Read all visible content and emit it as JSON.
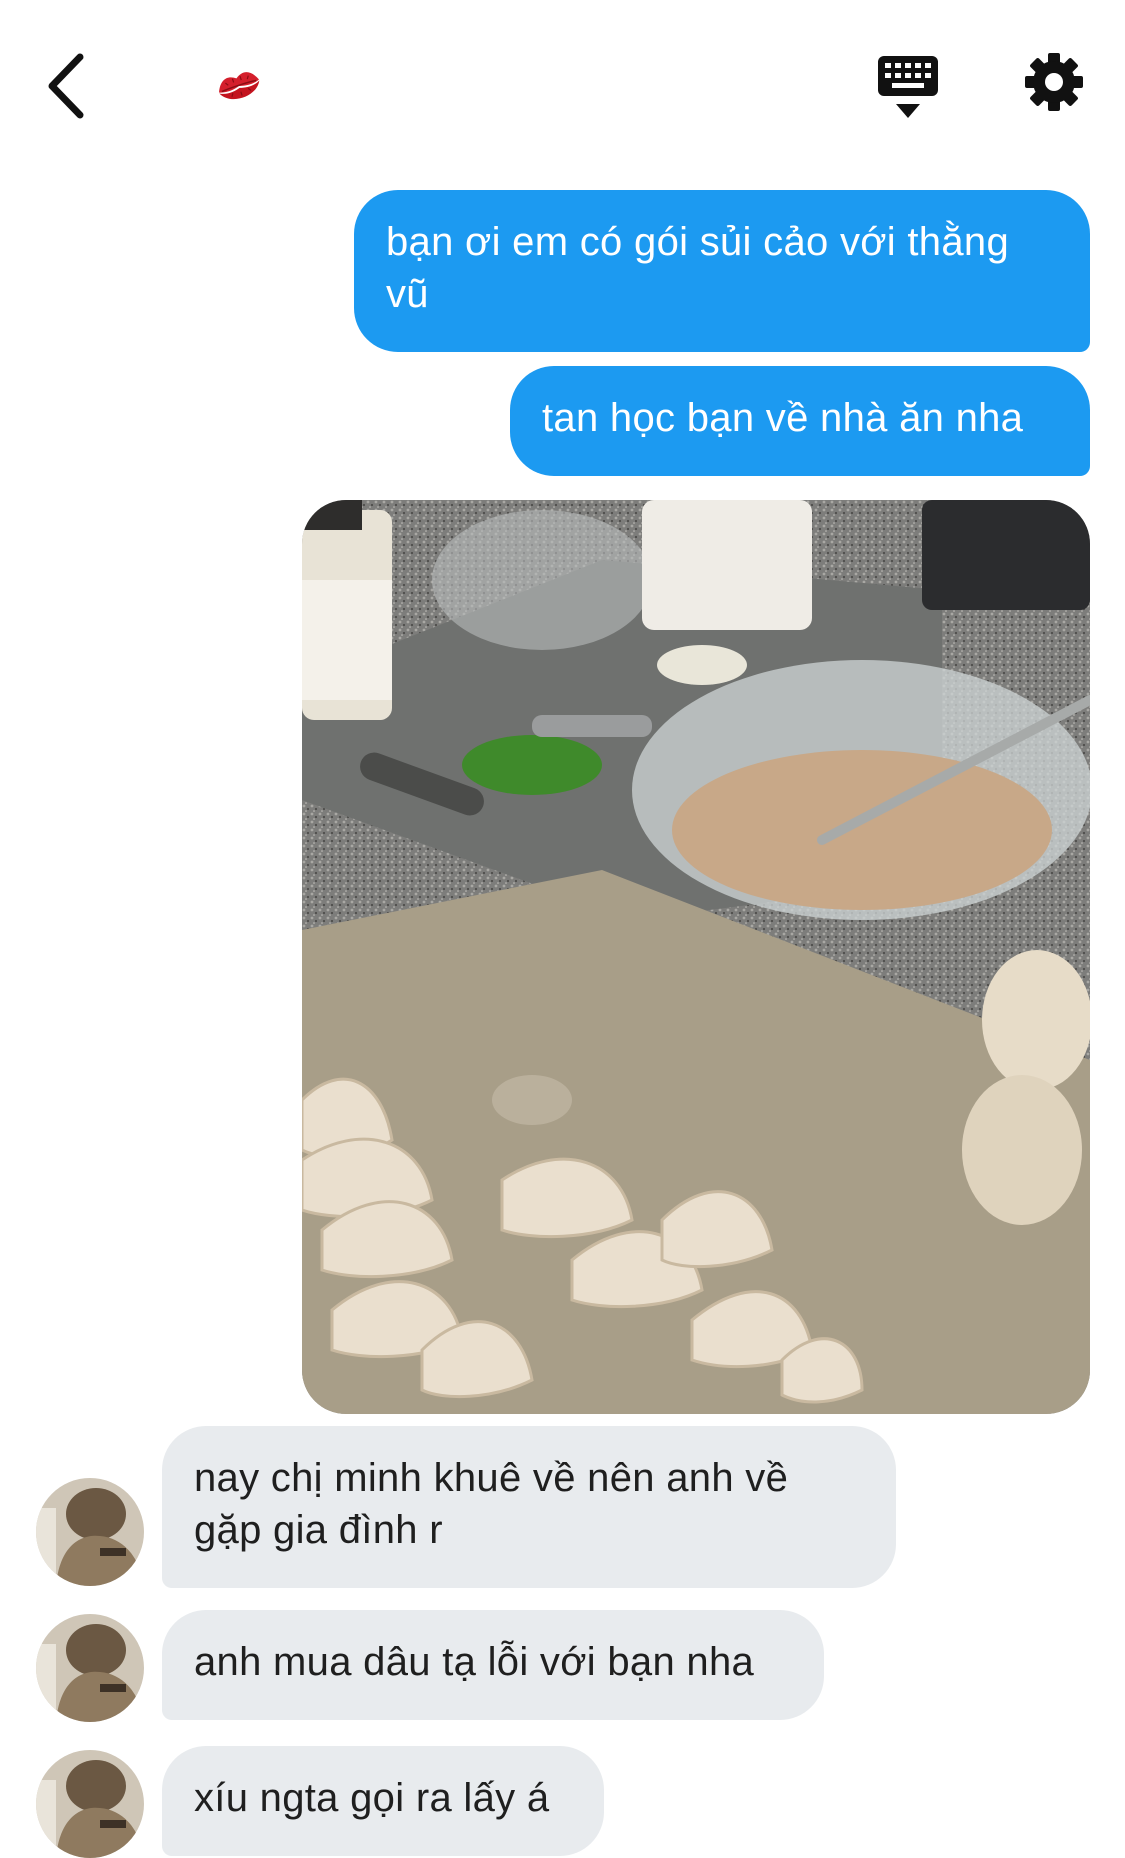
{
  "header": {
    "back_icon": "chevron-left-icon",
    "contact_icon": "kiss-lips-icon",
    "keyboard_icon": "keyboard-hide-icon",
    "settings_icon": "gear-icon"
  },
  "colors": {
    "outgoing_bubble": "#1c9af1",
    "incoming_bubble": "#e8ebee",
    "lips": "#d41f2c"
  },
  "messages": [
    {
      "direction": "outgoing",
      "text": "bạn ơi em có gói sủi cảo với thằng vũ"
    },
    {
      "direction": "outgoing",
      "text": "tan học bạn về nhà ăn nha"
    },
    {
      "direction": "outgoing",
      "type": "photo"
    },
    {
      "direction": "incoming",
      "text": "nay chị minh khuê về nên anh về gặp gia đình r"
    },
    {
      "direction": "incoming",
      "text": "anh mua dâu tạ lỗi với bạn nha"
    },
    {
      "direction": "incoming",
      "text": "xíu ngta gọi ra lấy á"
    }
  ]
}
